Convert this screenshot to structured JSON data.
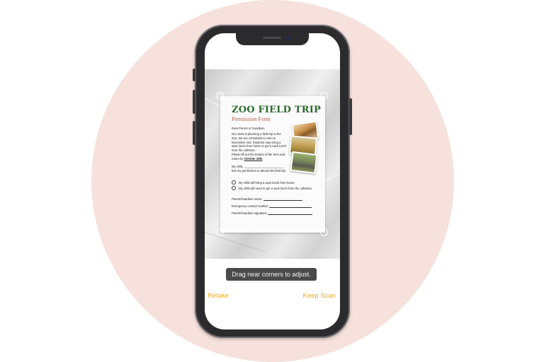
{
  "colors": {
    "background_circle": "#f6e1dc",
    "phone_frame": "#2b2b2d",
    "accent": "#e9ac1c",
    "title_green": "#2f6b2f",
    "subtitle_red": "#b25a4a",
    "hint_bg": "#4a4a4a"
  },
  "document": {
    "title": "ZOO FIELD TRIP",
    "subtitle": "Permission Form",
    "greeting": "Dear Parent or Guardian,",
    "paragraph1": "Our class is planning a field trip to the Zoo. We are scheduled to visit on November 2nd. Students may bring a sack lunch from home or get a sack lunch from the cafeteria.",
    "paragraph2_prefix": "Please fill out the bottom of the form and return by ",
    "paragraph2_date": "October 28th",
    "paragraph2_suffix": ".",
    "permission_line": "My child, ________________________ has my permission to attend this field trip.",
    "photos": [
      "giraffe-photo",
      "meerkat-photo",
      "elephant-photo"
    ],
    "options": [
      "My child will bring a sack lunch from home.",
      "My child will need to get a sack lunch from the cafeteria."
    ],
    "fields": [
      "Parent/Guardian name:",
      "Emergency contact number:",
      "Parent/Guardian signature:"
    ]
  },
  "scanner": {
    "hint": "Drag near corners to adjust.",
    "retake_label": "Retake",
    "keep_label": "Keep Scan"
  }
}
